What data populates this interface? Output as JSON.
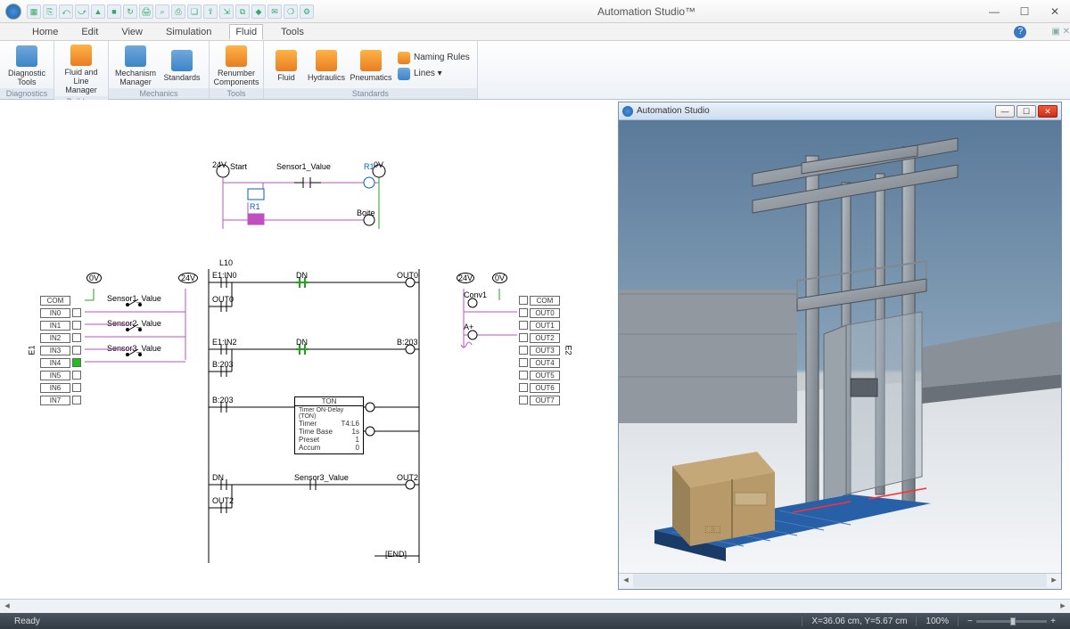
{
  "app": {
    "title": "Automation Studio™",
    "panel_title": "Automation Studio"
  },
  "menu": {
    "tabs": [
      "Home",
      "Edit",
      "View",
      "Simulation",
      "Fluid",
      "Tools"
    ],
    "active": 4
  },
  "ribbon": {
    "groups": [
      {
        "label": "Diagnostics",
        "buttons": [
          {
            "label": "Diagnostic\nTools"
          }
        ]
      },
      {
        "label": "Builders",
        "buttons": [
          {
            "label": "Fluid and\nLine Manager"
          }
        ]
      },
      {
        "label": "Mechanics",
        "buttons": [
          {
            "label": "Mechanism\nManager"
          },
          {
            "label": "Standards"
          }
        ]
      },
      {
        "label": "Tools",
        "buttons": [
          {
            "label": "Renumber\nComponents"
          }
        ]
      },
      {
        "label": "Standards",
        "buttons": [
          {
            "label": "Fluid"
          },
          {
            "label": "Hydraulics"
          },
          {
            "label": "Pneumatics"
          }
        ],
        "smalls": [
          {
            "label": "Naming Rules"
          },
          {
            "label": "Lines ▾"
          }
        ]
      }
    ]
  },
  "schematic": {
    "top": {
      "v24": "24V",
      "start": "Start",
      "sensor1": "Sensor1_Value",
      "r1": "R1",
      "v0": "0V",
      "r1b": "R1",
      "boite": "Boite"
    },
    "in_table": {
      "header": "COM",
      "v0": "0V",
      "v24": "24V",
      "rows": [
        "IN0",
        "IN1",
        "IN2",
        "IN3",
        "IN4",
        "IN5",
        "IN6",
        "IN7"
      ],
      "sensors": [
        "Sensor1_Value",
        "Sensor2_Value",
        "Sensor3_Value"
      ],
      "side": "E1"
    },
    "out_table": {
      "header": "COM",
      "v24": "24V",
      "v0": "0V",
      "conv": "Conv1",
      "aplus": "A+",
      "rows": [
        "OUT0",
        "OUT1",
        "OUT2",
        "OUT3",
        "OUT4",
        "OUT5",
        "OUT6",
        "OUT7"
      ],
      "side": "E2"
    },
    "ladder": {
      "title": "L10",
      "rung1": {
        "left": "E1:IN0",
        "mid": "DN",
        "right": "OUT0"
      },
      "out0": "OUT0",
      "rung2": {
        "left": "E1:IN2",
        "mid": "DN",
        "right": "B:203"
      },
      "b203a": "B:203",
      "b203b": "B:203",
      "ton": {
        "title": "TON",
        "sub": "Timer ON-Delay (TON)",
        "rows": [
          [
            "Timer",
            "T4:L6"
          ],
          [
            "Time Base",
            "1s"
          ],
          [
            "Preset",
            "1"
          ],
          [
            "Accum",
            "0"
          ]
        ]
      },
      "rung3": {
        "left": "DN",
        "mid": "Sensor3_Value",
        "right": "OUT2"
      },
      "out2": "OUT2",
      "end": "END"
    }
  },
  "status": {
    "ready": "Ready",
    "coords": "X=36.06 cm, Y=5.67 cm",
    "zoom": "100%"
  }
}
